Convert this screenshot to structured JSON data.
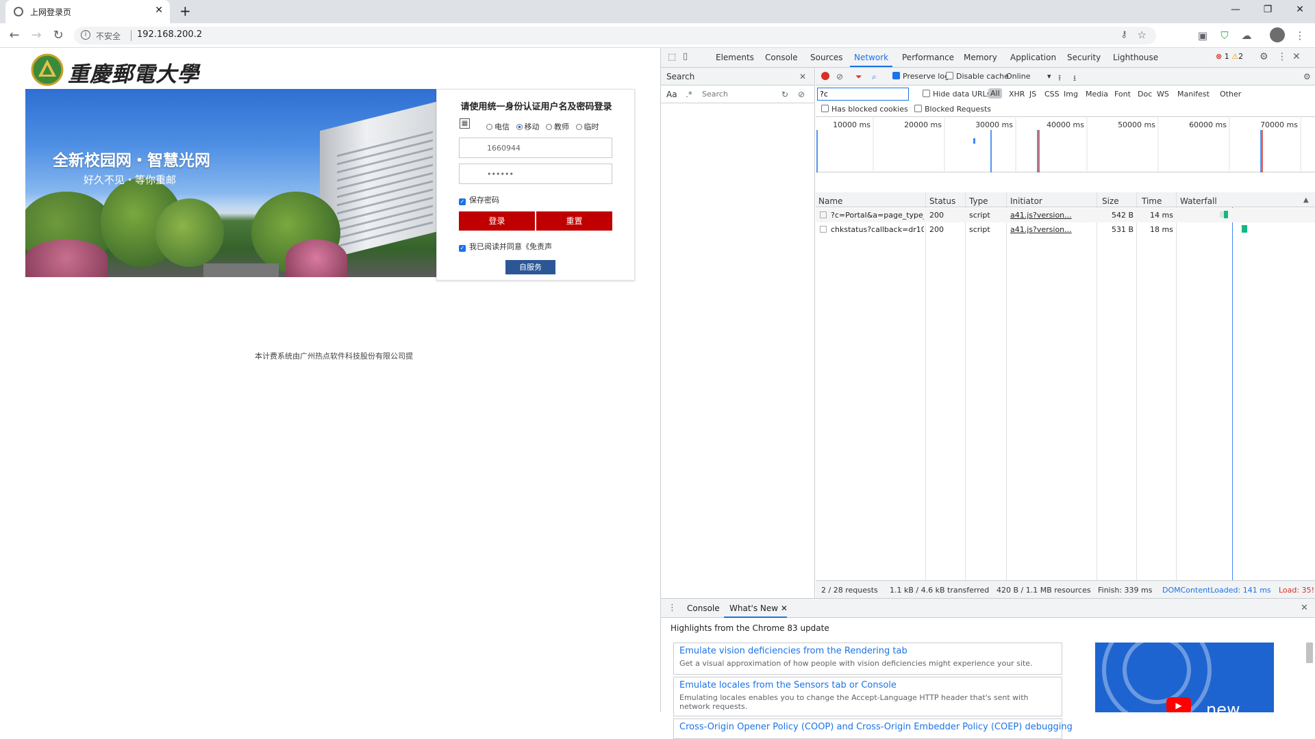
{
  "browser": {
    "tab_title": "上网登录页",
    "tab_close": "✕",
    "new_tab": "+",
    "window_controls": [
      "—",
      "❐",
      "✕"
    ],
    "security_label": "不安全",
    "url": "192.168.200.2"
  },
  "page": {
    "logo_text": "重慶郵電大學",
    "banner_title": "全新校园网・智慧光网",
    "banner_subtitle": "好久不见・等你重邮",
    "login_heading": "请使用统一身份认证用户名及密码登录",
    "operators": [
      "电信",
      "移动",
      "教师",
      "临时"
    ],
    "selected_operator": "移动",
    "username_value": "1660944",
    "password_value": "••••••",
    "save_password_label": "保存密码",
    "login_button": "登录",
    "reset_button": "重置",
    "agree_label": "我已阅读并同意《免责声",
    "self_service_button": "自服务",
    "footer_text": "本计费系统由广州热点软件科技股份有限公司提"
  },
  "devtools": {
    "tabs": [
      "Elements",
      "Console",
      "Sources",
      "Network",
      "Performance",
      "Memory",
      "Application",
      "Security",
      "Lighthouse"
    ],
    "selected_tab": "Network",
    "error_count": "1",
    "warning_count": "2",
    "search_panel_title": "Search",
    "search_aa": "Aa",
    "search_regex": ".*",
    "search_placeholder": "Search",
    "filter_value": "?c",
    "preserve_log_label": "Preserve log",
    "disable_cache_label": "Disable cache",
    "throttle_value": "Online",
    "hide_data_urls_label": "Hide data URLs",
    "type_filters": [
      "All",
      "XHR",
      "JS",
      "CSS",
      "Img",
      "Media",
      "Font",
      "Doc",
      "WS",
      "Manifest",
      "Other"
    ],
    "has_blocked_cookies_label": "Has blocked cookies",
    "blocked_requests_label": "Blocked Requests",
    "timeline_ticks": [
      "10000 ms",
      "20000 ms",
      "30000 ms",
      "40000 ms",
      "50000 ms",
      "60000 ms",
      "70000 ms"
    ],
    "columns": [
      "Name",
      "Status",
      "Type",
      "Initiator",
      "Size",
      "Time",
      "Waterfall"
    ],
    "requests": [
      {
        "name": "?c=Portal&a=page_type_data...",
        "status": "200",
        "type": "script",
        "initiator": "a41.js?version...",
        "size": "542 B",
        "time": "14 ms"
      },
      {
        "name": "chkstatus?callback=dr1002&v...",
        "status": "200",
        "type": "script",
        "initiator": "a41.js?version...",
        "size": "531 B",
        "time": "18 ms"
      }
    ],
    "status_bar": {
      "requests": "2 / 28 requests",
      "transferred": "1.1 kB / 4.6 kB transferred",
      "resources": "420 B / 1.1 MB resources",
      "finish": "Finish: 339 ms",
      "dom_loaded": "DOMContentLoaded: 141 ms",
      "load": "Load: 35!"
    },
    "drawer": {
      "tabs": [
        "Console",
        "What's New"
      ],
      "selected_tab": "What's New",
      "heading": "Highlights from the Chrome 83 update",
      "cards": [
        {
          "title": "Emulate vision deficiencies from the Rendering tab",
          "desc": "Get a visual approximation of how people with vision deficiencies might experience your site."
        },
        {
          "title": "Emulate locales from the Sensors tab or Console",
          "desc": "Emulating locales enables you to change the Accept-Language HTTP header that's sent with network requests."
        },
        {
          "title": "Cross-Origin Opener Policy (COOP) and Cross-Origin Embedder Policy (COEP) debugging",
          "desc": ""
        }
      ],
      "video_text": "new"
    }
  }
}
